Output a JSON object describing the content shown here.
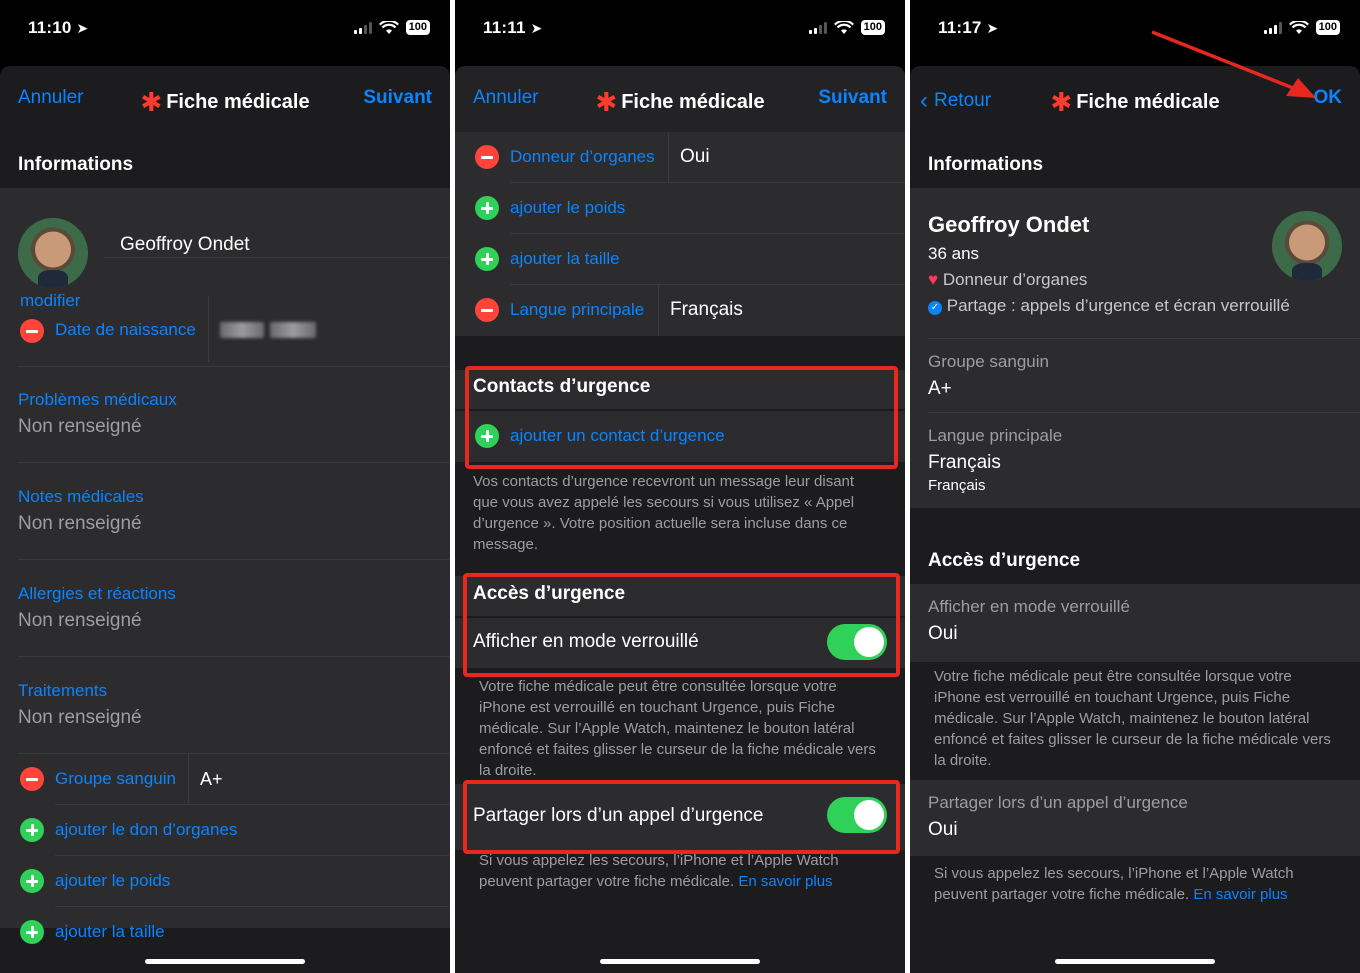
{
  "phones": [
    {
      "status": {
        "time": "11:10",
        "battery": "100"
      },
      "nav": {
        "left": "Annuler",
        "title": "Fiche médicale",
        "right": "Suivant"
      },
      "section_title": "Informations",
      "name": "Geoffroy Ondet",
      "edit_label": "modifier",
      "birthdate_label": "Date de naissance",
      "fields": [
        {
          "label": "Problèmes médicaux",
          "value": "Non renseigné"
        },
        {
          "label": "Notes médicales",
          "value": "Non renseigné"
        },
        {
          "label": "Allergies et réactions",
          "value": "Non renseigné"
        },
        {
          "label": "Traitements",
          "value": "Non renseigné"
        }
      ],
      "blood": {
        "label": "Groupe sanguin",
        "value": "A+"
      },
      "add_rows": [
        "ajouter le don d’organes",
        "ajouter le poids",
        "ajouter la taille"
      ]
    },
    {
      "status": {
        "time": "11:11",
        "battery": "100"
      },
      "nav": {
        "left": "Annuler",
        "title": "Fiche médicale",
        "right": "Suivant"
      },
      "organ": {
        "label": "Donneur d’organes",
        "value": "Oui"
      },
      "add_weight": "ajouter le poids",
      "add_height": "ajouter la taille",
      "language": {
        "label": "Langue principale",
        "value": "Français"
      },
      "contacts_title": "Contacts d’urgence",
      "add_contact": "ajouter un contact d’urgence",
      "contacts_note": "Vos contacts d’urgence recevront un message leur disant que vous avez appelé les secours si vous utilisez « Appel d’urgence ». Votre position actuelle sera incluse dans ce message.",
      "access_title": "Accès d’urgence",
      "lock_label": "Afficher en mode verrouillé",
      "lock_note": "Votre fiche médicale peut être consultée lorsque votre iPhone est verrouillé en touchant Urgence, puis Fiche médicale. Sur l’Apple Watch, maintenez le bouton latéral enfoncé et faites glisser le curseur de la fiche médicale vers la droite.",
      "share_label": "Partager lors d’un appel d’urgence",
      "share_note": "Si vous appelez les secours, l’iPhone et l’Apple Watch peuvent partager votre fiche médicale.",
      "learn_more": "En savoir plus"
    },
    {
      "status": {
        "time": "11:17",
        "battery": "100"
      },
      "nav": {
        "left": "Retour",
        "title": "Fiche médicale",
        "right": "OK"
      },
      "section_title": "Informations",
      "name": "Geoffroy Ondet",
      "age": "36 ans",
      "organ_donor": "Donneur d’organes",
      "sharing": "Partage : appels d’urgence et écran verrouillé",
      "blood": {
        "label": "Groupe sanguin",
        "value": "A+"
      },
      "language": {
        "label": "Langue principale",
        "value": "Français",
        "sub": "Français"
      },
      "access_title": "Accès d’urgence",
      "lock": {
        "label": "Afficher en mode verrouillé",
        "value": "Oui"
      },
      "lock_note": "Votre fiche médicale peut être consultée lorsque votre iPhone est verrouillé en touchant Urgence, puis Fiche médicale. Sur l’Apple Watch, maintenez le bouton latéral enfoncé et faites glisser le curseur de la fiche médicale vers la droite.",
      "share": {
        "label": "Partager lors d’un appel d’urgence",
        "value": "Oui"
      },
      "share_note": "Si vous appelez les secours, l’iPhone et l’Apple Watch peuvent partager votre fiche médicale.",
      "learn_more": "En savoir plus"
    }
  ],
  "colors": {
    "accent": "#0a84ff",
    "highlight": "#e8281e",
    "toggle_on": "#30d158",
    "remove": "#ff453a"
  }
}
